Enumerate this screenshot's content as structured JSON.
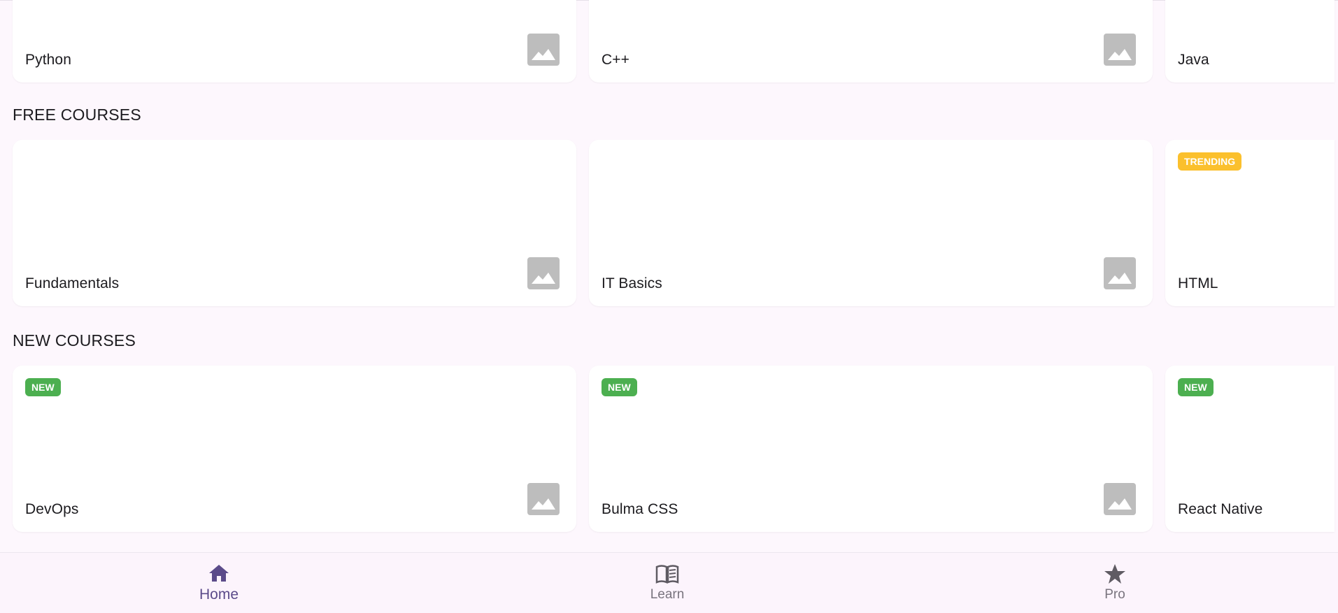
{
  "rows": [
    {
      "title": "",
      "cards": [
        {
          "title": "Python",
          "badge": "",
          "badge_color": "",
          "has_image": true
        },
        {
          "title": "C++",
          "badge": "",
          "badge_color": "",
          "has_image": true
        },
        {
          "title": "Java",
          "badge": "",
          "badge_color": "",
          "has_image": false
        }
      ]
    },
    {
      "title": "FREE COURSES",
      "cards": [
        {
          "title": "Fundamentals",
          "badge": "",
          "badge_color": "",
          "has_image": true
        },
        {
          "title": "IT Basics",
          "badge": "",
          "badge_color": "",
          "has_image": true
        },
        {
          "title": "HTML",
          "badge": "TRENDING",
          "badge_color": "#fbc02d",
          "has_image": false
        }
      ]
    },
    {
      "title": "NEW COURSES",
      "cards": [
        {
          "title": "DevOps",
          "badge": "NEW",
          "badge_color": "#4caf50",
          "has_image": true
        },
        {
          "title": "Bulma CSS",
          "badge": "NEW",
          "badge_color": "#4caf50",
          "has_image": true
        },
        {
          "title": "React Native",
          "badge": "NEW",
          "badge_color": "#4caf50",
          "has_image": false
        }
      ]
    }
  ],
  "nav": {
    "items": [
      {
        "label": "Home",
        "icon": "home-icon",
        "active": true
      },
      {
        "label": "Learn",
        "icon": "book-icon",
        "active": false
      },
      {
        "label": "Pro",
        "icon": "star-icon",
        "active": false
      }
    ],
    "active_color": "#5b4b8a",
    "inactive_color": "#79747e"
  },
  "colors": {
    "background": "#fdf7fd",
    "card": "#ffffff",
    "image_placeholder": "#bdbdbd"
  }
}
